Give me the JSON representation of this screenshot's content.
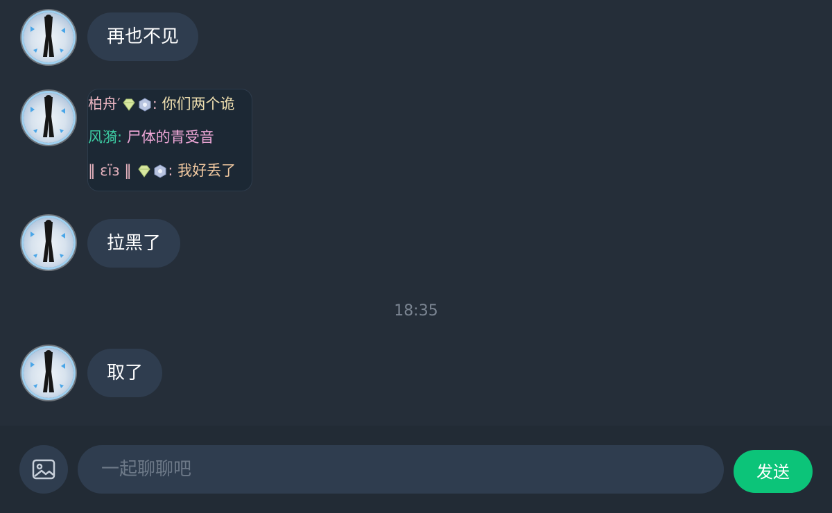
{
  "messages": [
    {
      "text": "再也不见"
    },
    {
      "type": "card",
      "lines": [
        {
          "sender": "柏舟′",
          "badges": true,
          "sep": ": ",
          "text": "你们两个诡",
          "sender_color": "#e8b4c0",
          "text_color": "#f0e0b0"
        },
        {
          "sender": "风漪",
          "badges": false,
          "sep": ": ",
          "text": "尸体的青受音",
          "sender_color": "#3cc8a0",
          "text_color": "#f0a8d8"
        },
        {
          "sender": "‖ εïз ‖",
          "badges": true,
          "sep": ": ",
          "text": "我好丢了",
          "sender_color": "#e8b4c0",
          "text_color": "#f0c8a0"
        }
      ]
    },
    {
      "text": "拉黑了"
    },
    {
      "text": "取了"
    }
  ],
  "timestamp": "18:35",
  "composer": {
    "placeholder": "一起聊聊吧",
    "send_label": "发送",
    "image_icon": "image-icon"
  },
  "colors": {
    "background": "#252e39",
    "bubble": "#2f3d4f",
    "send_button": "#0cc479"
  }
}
